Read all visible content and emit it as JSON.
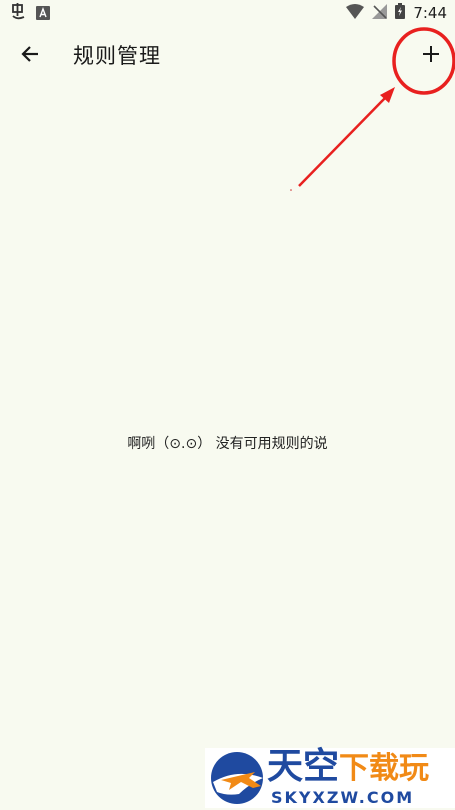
{
  "status_bar": {
    "time": "7:44"
  },
  "toolbar": {
    "title": "规则管理"
  },
  "main": {
    "empty_message": "啊咧（⊙.⊙） 没有可用规则的说"
  },
  "watermark": {
    "title_main": "天空",
    "title_accent": "下载玩",
    "url": "SKYXZW.COM"
  },
  "colors": {
    "background": "#f8faf0",
    "annotation_red": "#e8201f",
    "watermark_blue": "#1f4aa0",
    "watermark_orange": "#f18a16"
  },
  "icons": {
    "back": "arrow-left-icon",
    "add": "plus-icon"
  }
}
